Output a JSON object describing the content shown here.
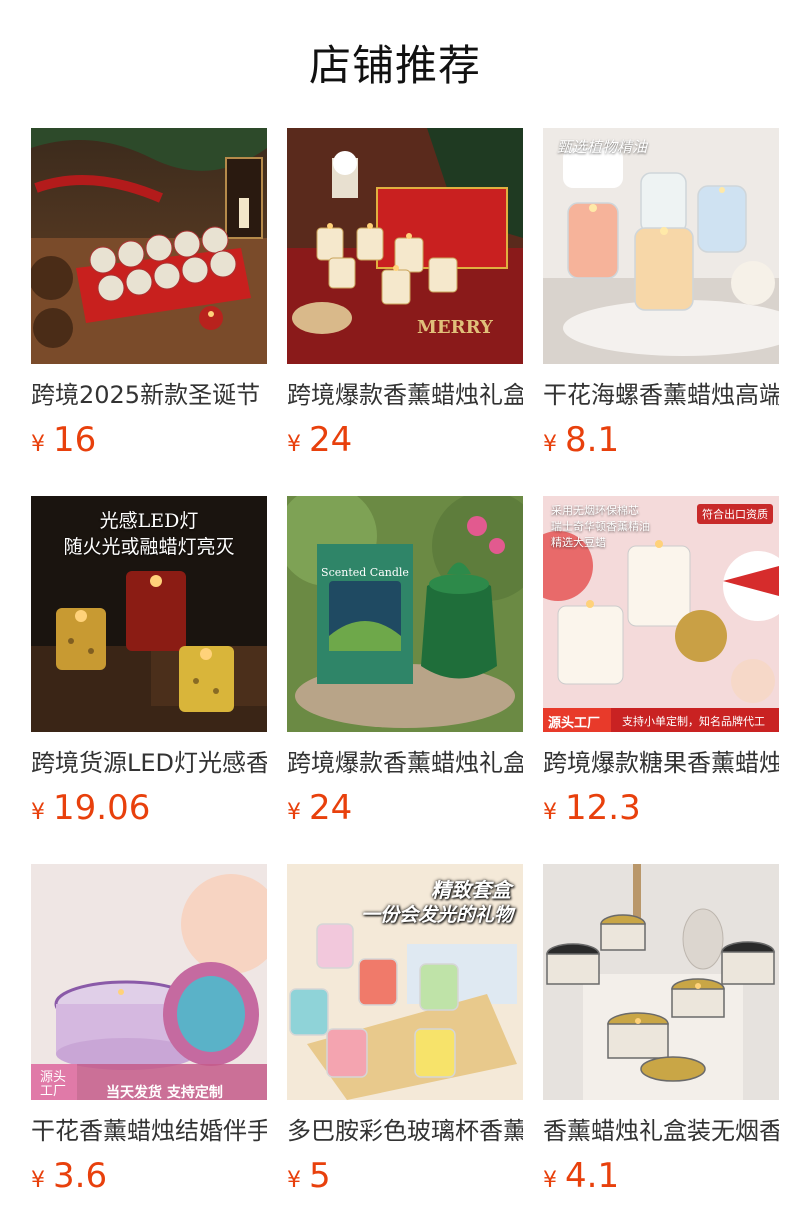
{
  "header": {
    "title": "店铺推荐"
  },
  "currency": "¥",
  "colors": {
    "price": "#e8400c",
    "title": "#111111",
    "name": "#333333"
  },
  "products": [
    {
      "name": "跨境2025新款圣诞节",
      "price": "16",
      "image": "christmas-tin-candle-gift-box"
    },
    {
      "name": "跨境爆款香薰蜡烛礼盒",
      "price": "24",
      "image": "christmas-glass-candle-set"
    },
    {
      "name": "干花海螺香薰蜡烛高端",
      "price": "8.1",
      "image": "jelly-gel-candles",
      "overlay": "甄选植物精油"
    },
    {
      "name": "跨境货源LED灯光感香薰",
      "price": "19.06",
      "image": "led-flameless-candles",
      "overlay": [
        "光感LED灯",
        "随火光或融蜡灯亮灭"
      ]
    },
    {
      "name": "跨境爆款香薰蜡烛礼盒",
      "price": "24",
      "image": "green-scented-candle-box",
      "overlay": "Scented Candle"
    },
    {
      "name": "跨境爆款糖果香薰蜡烛",
      "price": "12.3",
      "image": "birthday-scented-candle",
      "overlay": [
        "采用无烟环保棉芯",
        "瑞士奇华顿香薰精油",
        "精选大豆蜡"
      ],
      "badge_top": "符合出口资质",
      "banner_left": "源头工厂",
      "banner_right": "支持小单定制，知名品牌代工"
    },
    {
      "name": "干花香薰蜡烛结婚伴手礼",
      "price": "3.6",
      "image": "mandala-tin-candle",
      "banner_left": "源头工厂",
      "banner_right": "当天发货 支持定制"
    },
    {
      "name": "多巴胺彩色玻璃杯香薰",
      "price": "5",
      "image": "colorful-glass-cup-candles",
      "overlay": [
        "精致套盒",
        "一份会发光的礼物"
      ]
    },
    {
      "name": "香薰蜡烛礼盒装无烟香薰",
      "price": "4.1",
      "image": "tin-travel-candles"
    }
  ]
}
